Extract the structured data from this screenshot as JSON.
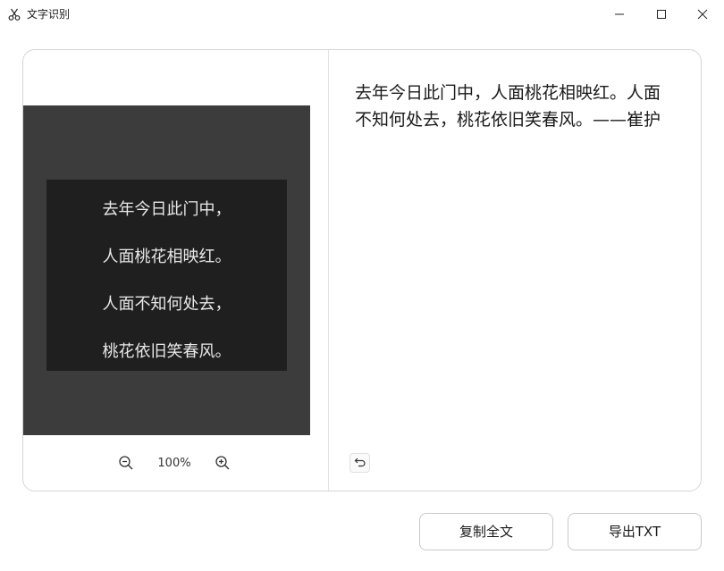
{
  "window": {
    "title": "文字识别",
    "icons": {
      "app": "scissors-icon",
      "minimize": "minimize-icon",
      "maximize": "maximize-icon",
      "close": "close-icon"
    }
  },
  "image_preview": {
    "lines": [
      "去年今日此门中，",
      "人面桃花相映红。",
      "人面不知何处去，",
      "桃花依旧笑春风。"
    ],
    "colors": {
      "outer": "#3c3c3c",
      "inner": "#1f1f1f",
      "text": "#e8e8e8"
    }
  },
  "zoom": {
    "level": "100%",
    "icons": {
      "out": "zoom-out-icon",
      "in": "zoom-in-icon"
    }
  },
  "result": {
    "text": "去年今日此门中，人面桃花相映红。人面不知何处去，桃花依旧笑春风。——崔护",
    "undo_icon": "undo-icon"
  },
  "actions": {
    "copy_all": "复制全文",
    "export_txt": "导出TXT"
  }
}
